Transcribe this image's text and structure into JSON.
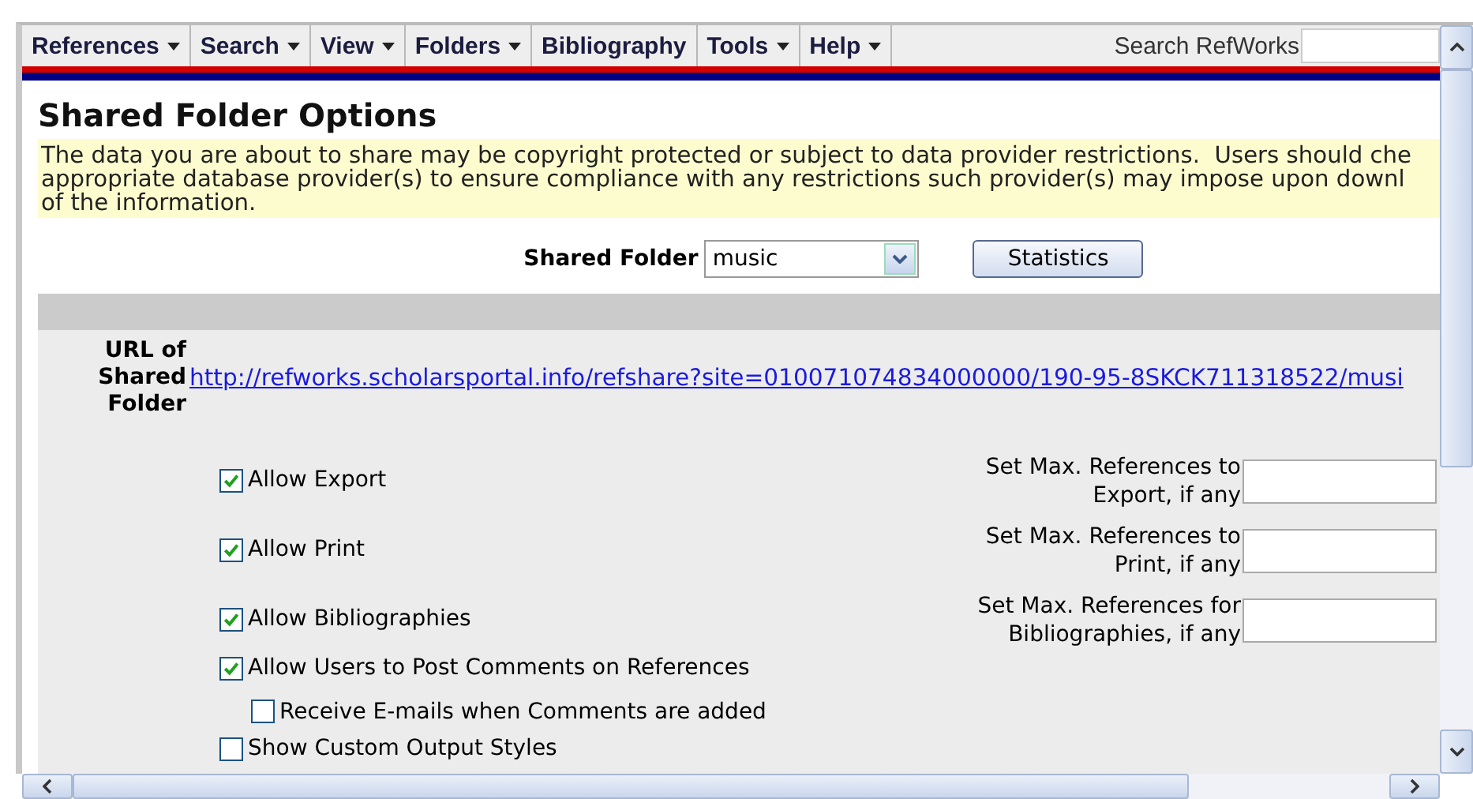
{
  "menu": [
    {
      "label": "References",
      "dropdown": true
    },
    {
      "label": "Search",
      "dropdown": true
    },
    {
      "label": "View",
      "dropdown": true
    },
    {
      "label": "Folders",
      "dropdown": true
    },
    {
      "label": "Bibliography",
      "dropdown": false
    },
    {
      "label": "Tools",
      "dropdown": true
    },
    {
      "label": "Help",
      "dropdown": true
    }
  ],
  "search": {
    "label": "Search RefWorks"
  },
  "page_title": "Shared Folder Options",
  "notice_lines": [
    "The data you are about to share may be copyright protected or subject to data provider restrictions.  Users should che",
    "appropriate database provider(s) to ensure compliance with any restrictions such provider(s) may impose upon downl",
    "of the information."
  ],
  "folder": {
    "label": "Shared Folder",
    "value": "music",
    "button": "Statistics"
  },
  "url": {
    "label": "URL of Shared Folder",
    "link": "http://refworks.scholarsportal.info/refshare?site=010071074834000000/190-95-8SKCK711318522/musi"
  },
  "options": [
    {
      "label": "Allow Export",
      "checked": true,
      "limit_label": "Set Max. References to Export, if any"
    },
    {
      "label": "Allow Print",
      "checked": true,
      "limit_label": "Set Max. References to Print, if any"
    },
    {
      "label": "Allow Bibliographies",
      "checked": true,
      "limit_label": "Set Max. References for Bibliographies, if any"
    },
    {
      "label": "Allow Users to Post Comments on References",
      "checked": true,
      "children": [
        {
          "label": "Receive E-mails when Comments are added",
          "checked": false
        }
      ]
    },
    {
      "label": "Show Custom Output Styles",
      "checked": false
    }
  ]
}
